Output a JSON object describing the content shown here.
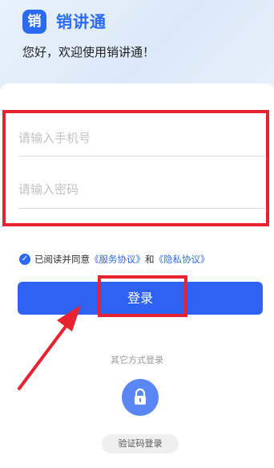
{
  "header": {
    "logo_char": "销",
    "app_name": "销讲通",
    "welcome": "您好，欢迎使用销讲通！"
  },
  "form": {
    "phone_placeholder": "请输入手机号",
    "password_placeholder": "请输入密码"
  },
  "agreement": {
    "checked": true,
    "prefix": "已阅读并同意",
    "service_link": "《服务协议》",
    "and": "和",
    "privacy_link": "《隐私协议》"
  },
  "login_button": {
    "label": "登录"
  },
  "other_login": {
    "title": "其它方式登录",
    "sms_label": "验证码登录",
    "lock_icon": "lock-icon"
  },
  "colors": {
    "primary": "#2b6af3",
    "button": "#2e62f2",
    "annotation": "#e8232f"
  }
}
